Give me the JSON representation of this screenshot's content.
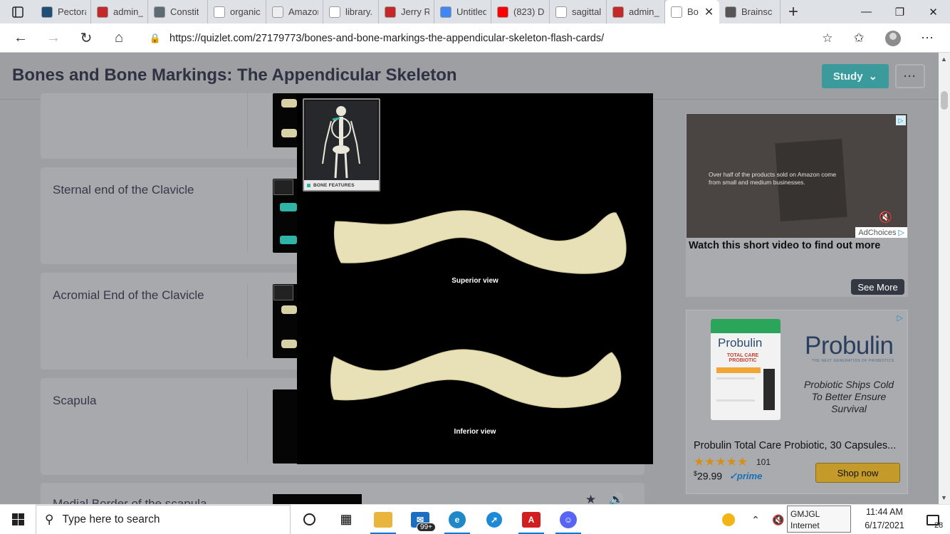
{
  "browser": {
    "tabs": [
      {
        "title": "Pectora",
        "favicon": "doc-icon",
        "color": "#1f4e79"
      },
      {
        "title": "admin_",
        "favicon": "pdf-icon",
        "color": "#c62828"
      },
      {
        "title": "Constit",
        "favicon": "doc-icon",
        "color": "#5f6b73"
      },
      {
        "title": "organic",
        "favicon": "google-icon",
        "color": "#ffffff"
      },
      {
        "title": "Amazon",
        "favicon": "amazon-icon",
        "color": "#eeeeee"
      },
      {
        "title": "library.",
        "favicon": "page-icon",
        "color": "#ffffff"
      },
      {
        "title": "Jerry R",
        "favicon": "pdf-icon",
        "color": "#c62828"
      },
      {
        "title": "Untitled",
        "favicon": "docs-icon",
        "color": "#4285f4"
      },
      {
        "title": "(823) D",
        "favicon": "youtube-icon",
        "color": "#ff0000"
      },
      {
        "title": "sagittal",
        "favicon": "google-icon",
        "color": "#ffffff"
      },
      {
        "title": "admin_",
        "favicon": "pdf-icon",
        "color": "#c62828"
      },
      {
        "title": "Bo",
        "favicon": "page-icon",
        "color": "#ffffff",
        "active": true
      },
      {
        "title": "Brainsc",
        "favicon": "brain-icon",
        "color": "#555555"
      }
    ],
    "url": "https://quizlet.com/27179773/bones-and-bone-markings-the-appendicular-skeleton-flash-cards/"
  },
  "page": {
    "title": "Bones and Bone Markings: The Appendicular Skeleton",
    "study_label": "Study",
    "more_label": "···"
  },
  "cards": [
    {
      "term": "Sternal end of the Clavicle"
    },
    {
      "term": "Acromial End of the Clavicle"
    },
    {
      "term": "Scapula"
    },
    {
      "term": "Medial Border of the scapula"
    }
  ],
  "modal": {
    "inset_label": "BONE FEATURES",
    "caption_top": "Superior view",
    "caption_bottom": "Inferior view"
  },
  "ads": {
    "video": {
      "overlay_text": "Over half of the products sold on Amazon come from small and medium businesses.",
      "adchoices": "AdChoices",
      "title": "Watch this short video to find out more",
      "see_more": "See More"
    },
    "product": {
      "brand": "Probulin",
      "box_brand": "Probulin",
      "box_sub": "TOTAL CARE PROBIOTIC",
      "brand_sub": "THE NEXT GENERATION OF PROBIOTICS",
      "tagline": "Probiotic Ships Cold To Better Ensure Survival",
      "title": "Probulin Total Care Probiotic, 30 Capsules...",
      "rating_stars": "★★★★★",
      "rating_count": "101",
      "price_currency": "$",
      "price": "29.99",
      "prime": "✓prime",
      "shop_label": "Shop now"
    }
  },
  "taskbar": {
    "search_placeholder": "Type here to search",
    "mail_badge": "99+",
    "network_tooltip_line1": "GMJGL",
    "network_tooltip_line2": "Internet access",
    "time": "11:44 AM",
    "date": "6/17/2021",
    "notification_count": "28"
  }
}
